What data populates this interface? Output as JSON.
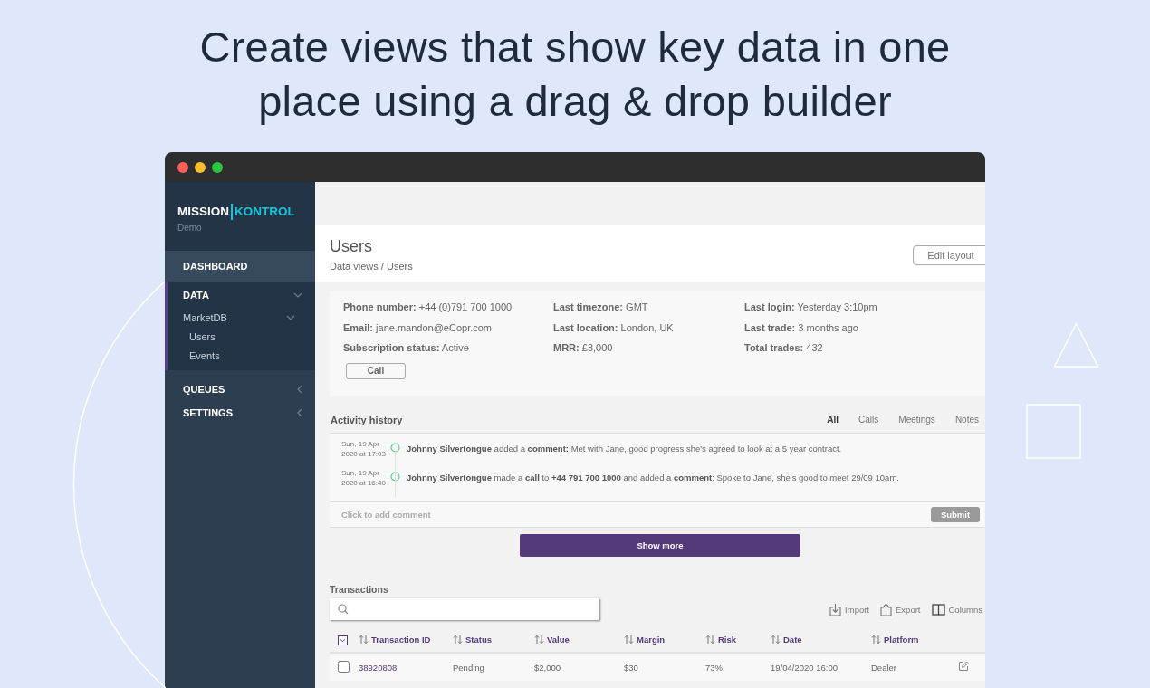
{
  "headline": "Create views that show key data in one place using a drag & drop builder",
  "sidebar": {
    "logo_left": "MISSION",
    "logo_right": "KONTROL",
    "subtitle": "Demo",
    "items": [
      {
        "label": "DASHBOARD",
        "hovered": true,
        "selected": false
      },
      {
        "label": "DATA",
        "hovered": false,
        "selected": true,
        "expanded": true,
        "children": [
          {
            "label": "MarketDB",
            "expanded": true,
            "children": [
              {
                "label": "Users"
              },
              {
                "label": "Events"
              }
            ]
          }
        ]
      },
      {
        "label": "QUEUES",
        "hovered": false,
        "selected": false,
        "expanded": false
      },
      {
        "label": "SETTINGS",
        "hovered": false,
        "selected": false,
        "expanded": false
      }
    ]
  },
  "page_header": {
    "title": "Users",
    "breadcrumb": "Data views / Users",
    "button": "Edit layout"
  },
  "profile": {
    "columns": [
      [
        {
          "label": "Phone number:",
          "value": "+44 (0)791 700 1000"
        },
        {
          "label": "Email:",
          "value": "jane.mandon@eCopr.com"
        },
        {
          "label": "Subscription status:",
          "value": "Active"
        }
      ],
      [
        {
          "label": "Last timezone:",
          "value": "GMT"
        },
        {
          "label": "Last location:",
          "value": "London, UK"
        },
        {
          "label": "MRR:",
          "value": "£3,000"
        }
      ],
      [
        {
          "label": "Last login:",
          "value": "Yesterday 3:10pm"
        },
        {
          "label": "Last trade:",
          "value": "3 months ago"
        },
        {
          "label": "Total trades:",
          "value": "432"
        }
      ]
    ],
    "button": "Call"
  },
  "activity": {
    "title": "Activity history",
    "filters": [
      {
        "label": "All",
        "selected": true
      },
      {
        "label": "Calls",
        "selected": false
      },
      {
        "label": "Meetings",
        "selected": false
      },
      {
        "label": "Notes",
        "selected": false
      }
    ],
    "entries": [
      {
        "date": "Sun, 19 Apr",
        "time": "2020 at 17:03",
        "text": "**Johnny Silvertongue** added a **comment:** Met with Jane, good progress she's agreed to look at a 5 year contract."
      },
      {
        "date": "Sun, 19 Apr",
        "time": "2020 at 16:40",
        "text": "**Johnny Silvertongue** made a **call** to **+44 791 700 1000** and added a **comment**: Spoke to Jane, she's good to meet 29/09 10am."
      }
    ],
    "comment_placeholder": "Click to add comment",
    "submit": {
      "label": "Submit",
      "disabled": true
    },
    "show_more": "Show more"
  },
  "transactions": {
    "title": "Transactions",
    "actions": [
      {
        "kind": "import",
        "label": "Import"
      },
      {
        "kind": "export",
        "label": "Export"
      },
      {
        "kind": "columns",
        "label": "Columns"
      }
    ],
    "columns": [
      "Transaction ID",
      "Status",
      "Value",
      "Margin",
      "Risk",
      "Date",
      "Platform"
    ],
    "rows": [
      {
        "checked": false,
        "cells": [
          "38920808",
          "Pending",
          "$2,000",
          "$30",
          "73%",
          "19/04/2020 16:00",
          "Dealer"
        ]
      }
    ]
  }
}
